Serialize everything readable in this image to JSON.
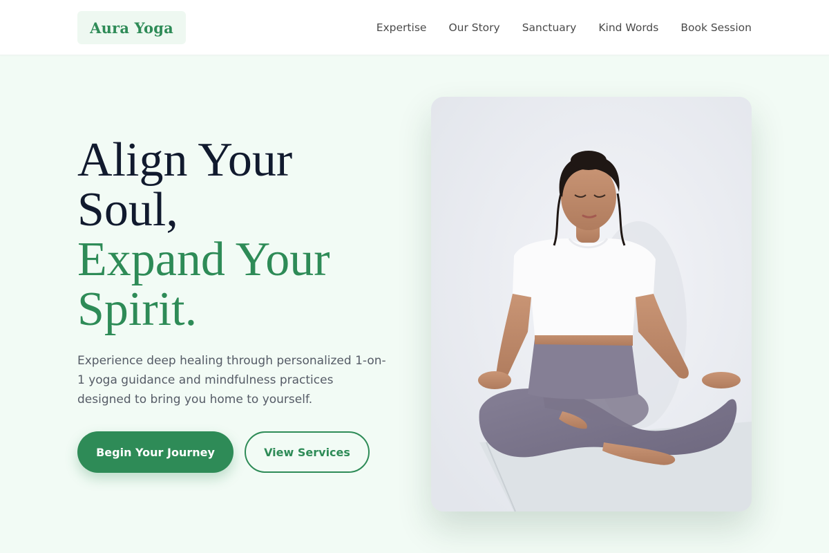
{
  "header": {
    "logo": "Aura Yoga",
    "nav": [
      "Expertise",
      "Our Story",
      "Sanctuary",
      "Kind Words",
      "Book Session"
    ]
  },
  "hero": {
    "title_lines": [
      "Align Your",
      "Soul,"
    ],
    "accent_lines": [
      "Expand Your",
      "Spirit."
    ],
    "description": "Experience deep healing through personalized 1-on-1 yoga guidance and mindfulness practices designed to bring you home to yourself.",
    "primary_button": "Begin Your Journey",
    "secondary_button": "View Services",
    "image_icon": "meditation-photo"
  },
  "colors": {
    "brand": "#2e8b57",
    "background": "#f2fbf5",
    "heading": "#111a2e",
    "body_text": "#555b66"
  }
}
